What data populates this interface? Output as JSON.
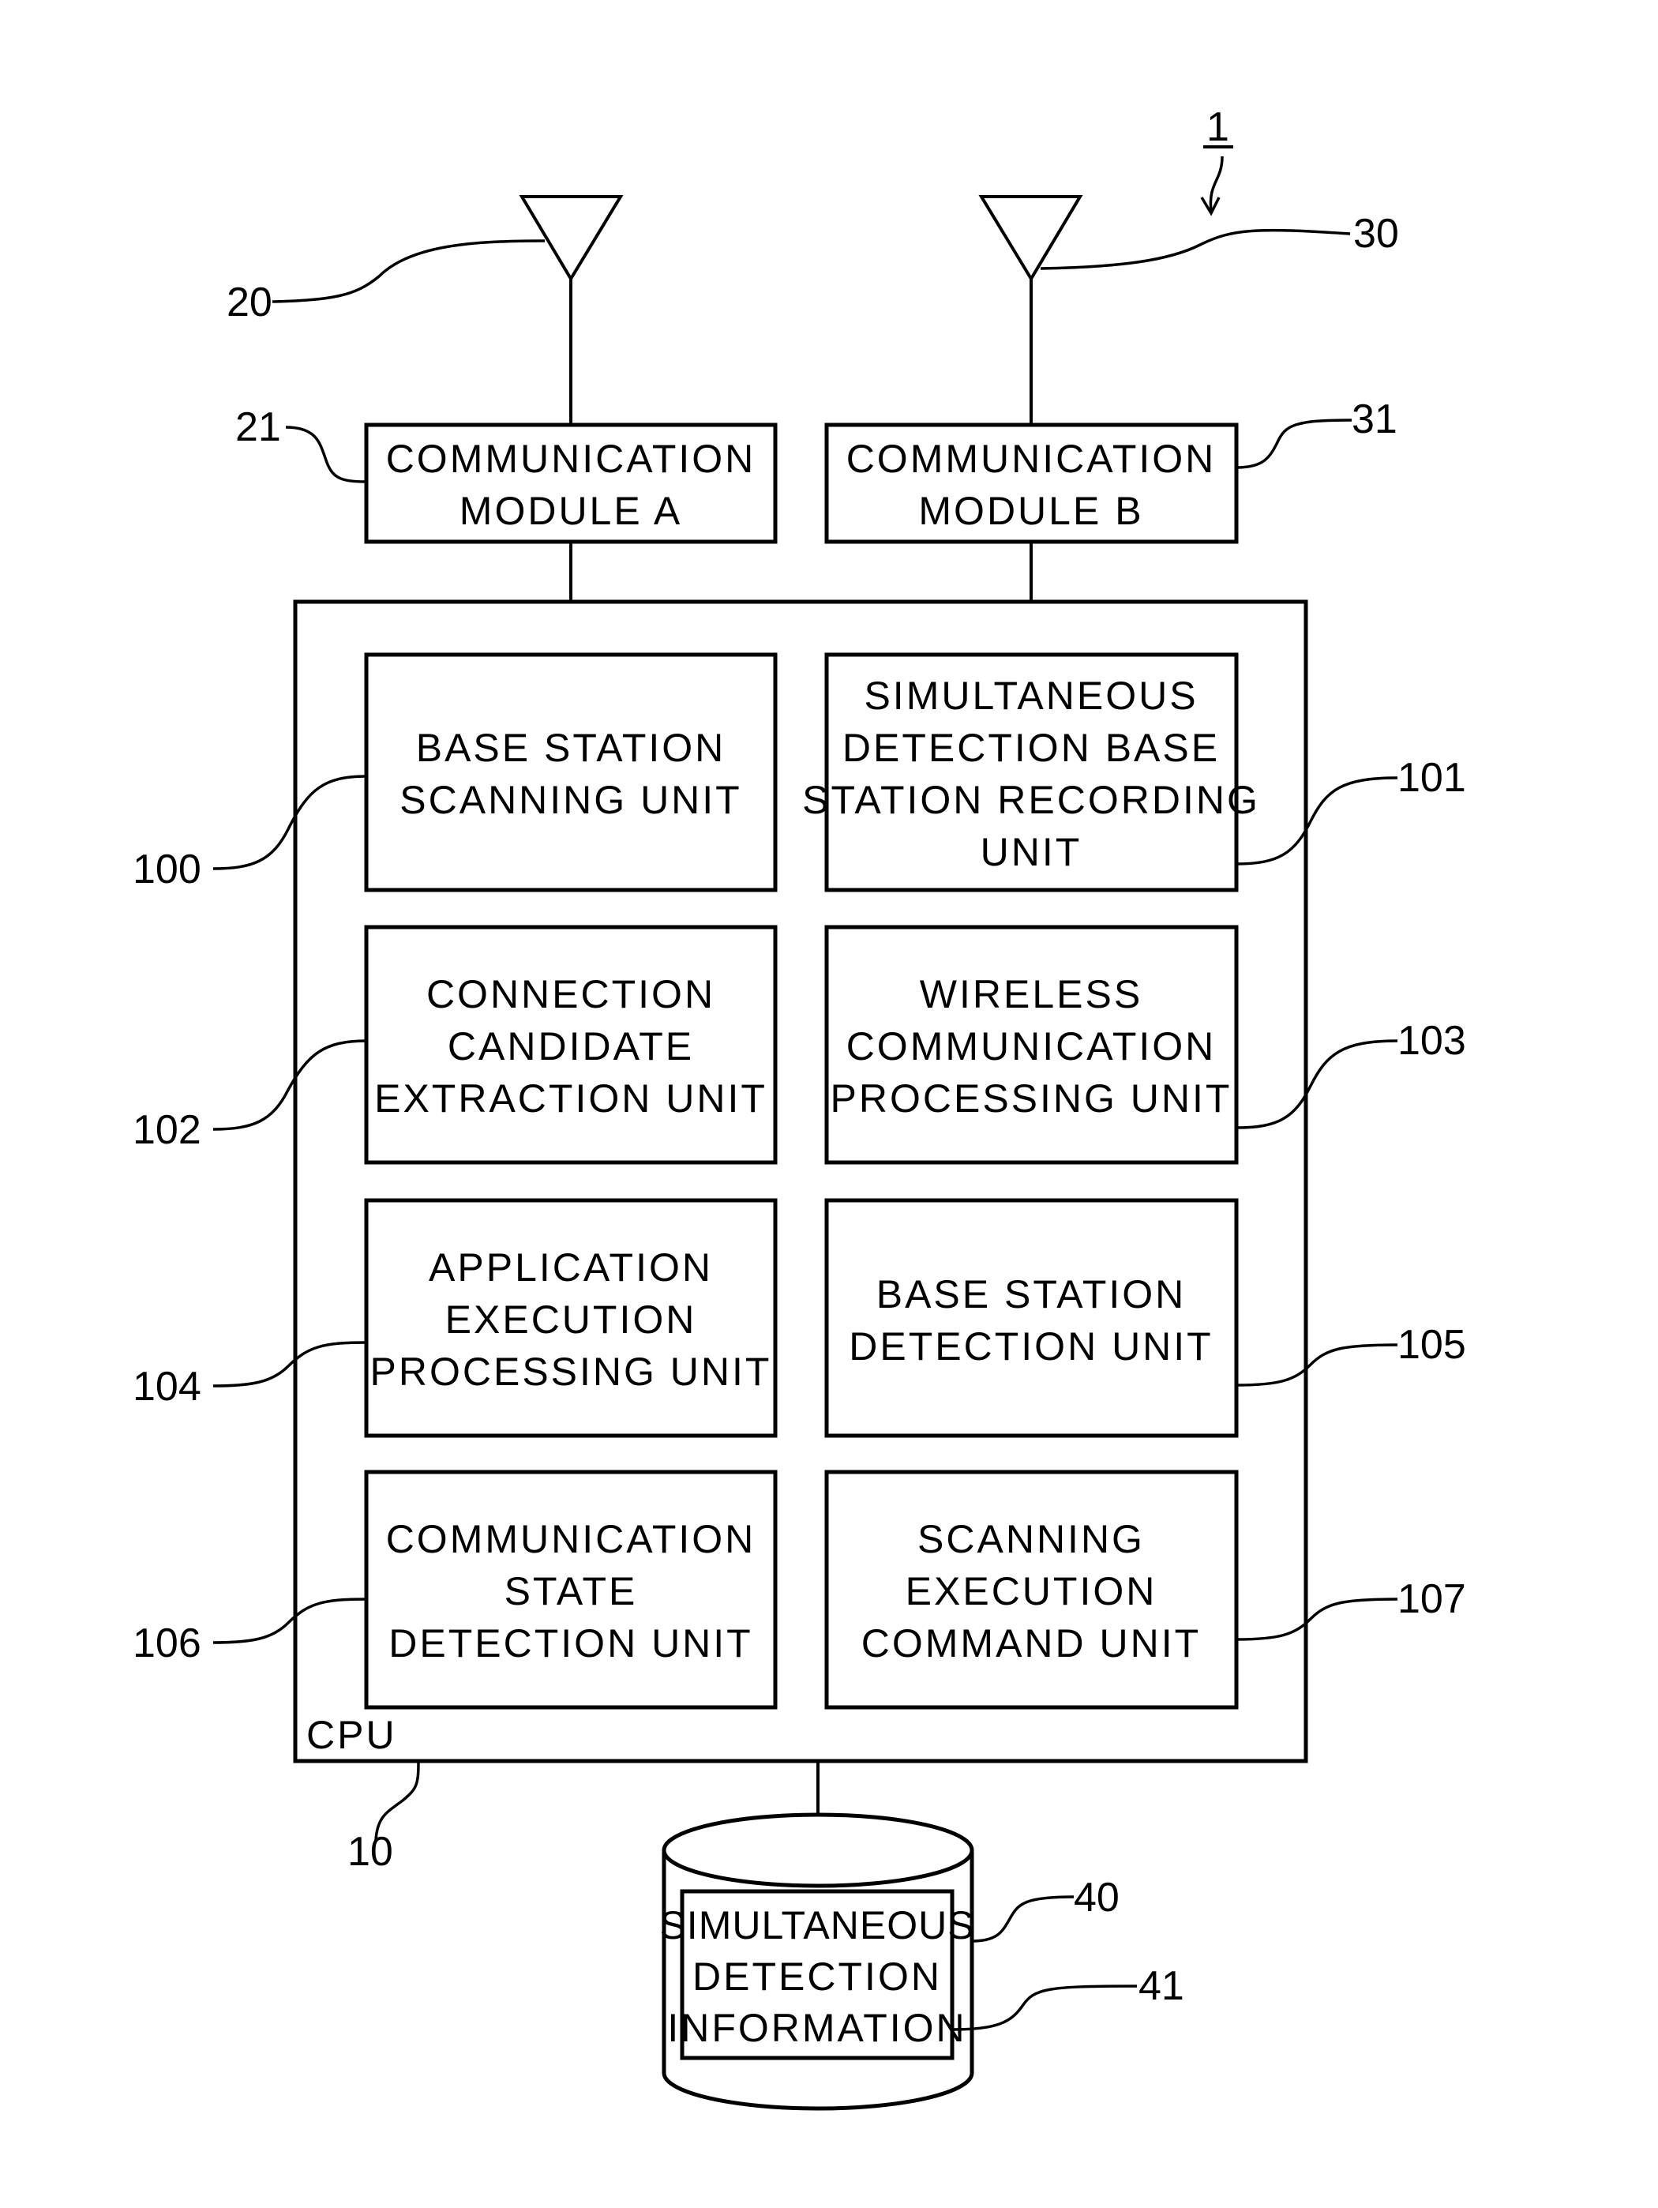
{
  "figure": {
    "reference": "1",
    "antennas": [
      {
        "ref": "20"
      },
      {
        "ref": "30"
      }
    ],
    "modules": [
      {
        "ref": "21",
        "lines": [
          "COMMUNICATION",
          "MODULE A"
        ]
      },
      {
        "ref": "31",
        "lines": [
          "COMMUNICATION",
          "MODULE B"
        ]
      }
    ],
    "cpu": {
      "label": "CPU",
      "ref": "10",
      "units": [
        {
          "ref": "100",
          "lines": [
            "BASE STATION",
            "SCANNING UNIT"
          ]
        },
        {
          "ref": "101",
          "lines": [
            "SIMULTANEOUS",
            "DETECTION BASE",
            "STATION RECORDING",
            "UNIT"
          ]
        },
        {
          "ref": "102",
          "lines": [
            "CONNECTION",
            "CANDIDATE",
            "EXTRACTION UNIT"
          ]
        },
        {
          "ref": "103",
          "lines": [
            "WIRELESS",
            "COMMUNICATION",
            "PROCESSING UNIT"
          ]
        },
        {
          "ref": "104",
          "lines": [
            "APPLICATION",
            "EXECUTION",
            "PROCESSING UNIT"
          ]
        },
        {
          "ref": "105",
          "lines": [
            "BASE STATION",
            "DETECTION UNIT"
          ]
        },
        {
          "ref": "106",
          "lines": [
            "COMMUNICATION",
            "STATE",
            "DETECTION UNIT"
          ]
        },
        {
          "ref": "107",
          "lines": [
            "SCANNING",
            "EXECUTION",
            "COMMAND UNIT"
          ]
        }
      ]
    },
    "storage": {
      "ref": "40",
      "info_ref": "41",
      "info_lines": [
        "SIMULTANEOUS",
        "DETECTION",
        "INFORMATION"
      ]
    }
  }
}
